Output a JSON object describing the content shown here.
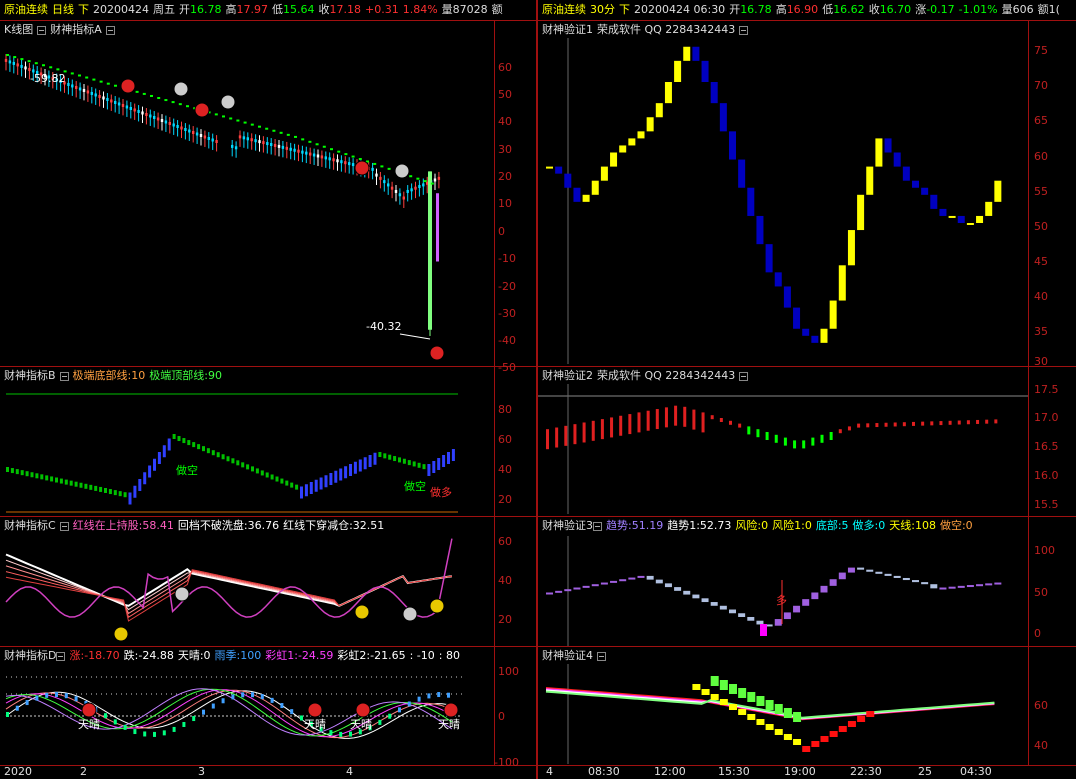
{
  "colors": {
    "up": "#ff2020",
    "down": "#00c8ff",
    "frame": "#a01010",
    "yellow": "#ffff00",
    "blue": "#0000c0",
    "green": "#00ff00",
    "axis": "#c02020"
  },
  "left_header": {
    "name": "原油连续",
    "period": "日线",
    "dir": "下",
    "date": "20200424",
    "weekday": "周五",
    "open_label": "开",
    "open": "16.78",
    "high_label": "高",
    "high": "17.97",
    "low_label": "低",
    "low": "15.64",
    "close_label": "收",
    "close": "17.18",
    "change": "+0.31",
    "pct": "1.84%",
    "vol_label": "量",
    "vol": "87028",
    "amt_label": "额"
  },
  "right_header": {
    "name": "原油连续",
    "period": "30分",
    "dir": "下",
    "datetime": "20200424 06:30",
    "open_label": "开",
    "open": "16.78",
    "high_label": "高",
    "high": "16.90",
    "low_label": "低",
    "low": "16.62",
    "close_label": "收",
    "close": "16.70",
    "chg_label": "涨",
    "change": "-0.17",
    "pct": "-1.01%",
    "vol_label": "量",
    "vol": "606",
    "amt_label": "额",
    "amt_partial": "1("
  },
  "panels": {
    "kline": {
      "title": "K线图",
      "sub": "财神指标A",
      "ticks": [
        "60",
        "50",
        "40",
        "30",
        "20",
        "10",
        "0",
        "-10",
        "-20",
        "-30",
        "-40",
        "-50"
      ],
      "label_high": "-59.82",
      "label_low": "-40.32"
    },
    "indB": {
      "title": "财神指标B",
      "l1": "极端底部线:10",
      "l2": "极端顶部线:90",
      "ticks": [
        "80",
        "60",
        "40",
        "20"
      ],
      "t1": "做空",
      "t2": "做空",
      "t3": "做多"
    },
    "indC": {
      "title": "财神指标C",
      "l1": "红线在上持股:58.41",
      "l2": "回档不破洗盘:36.76",
      "l3": "红线下穿减仓:32.51",
      "ticks": [
        "60",
        "40",
        "20"
      ]
    },
    "indD": {
      "title": "财神指标D",
      "l1": "涨:-18.70",
      "l2": "跌:-24.88",
      "l3": "天晴:0",
      "l4": "雨季:100",
      "l5": "彩虹1:-24.59",
      "l6": "彩虹2:-21.65",
      "l7": ": -10",
      "l8": ": 80",
      "ticks": [
        "100",
        "0",
        "-100"
      ],
      "sunny": "天晴"
    },
    "v1": {
      "title": "财神验证1",
      "sub": "荣成软件 QQ 2284342443",
      "ticks": [
        "75",
        "70",
        "65",
        "60",
        "55",
        "50",
        "45",
        "40",
        "35",
        "30"
      ]
    },
    "v2": {
      "title": "财神验证2",
      "sub": "荣成软件 QQ 2284342443",
      "ticks": [
        "17.5",
        "17.0",
        "16.5",
        "16.0",
        "15.5"
      ]
    },
    "v3": {
      "title": "财神验证3",
      "l1": "趋势:51.19",
      "l2": "趋势1:52.73",
      "l3": "风险:0",
      "l4": "风险1:0",
      "l5": "底部:5",
      "l6": "做多:0",
      "l7": "天线:108",
      "l8": "做空:0",
      "ticks": [
        "100",
        "50",
        "0"
      ],
      "duo": "多"
    },
    "v4": {
      "title": "财神验证4",
      "ticks": [
        "60",
        "40"
      ]
    }
  },
  "left_xaxis": [
    "2020",
    "2",
    "3",
    "4"
  ],
  "right_xaxis": [
    "4",
    "08:30",
    "12:00",
    "15:30",
    "19:00",
    "22:30",
    "25",
    "04:30"
  ]
}
